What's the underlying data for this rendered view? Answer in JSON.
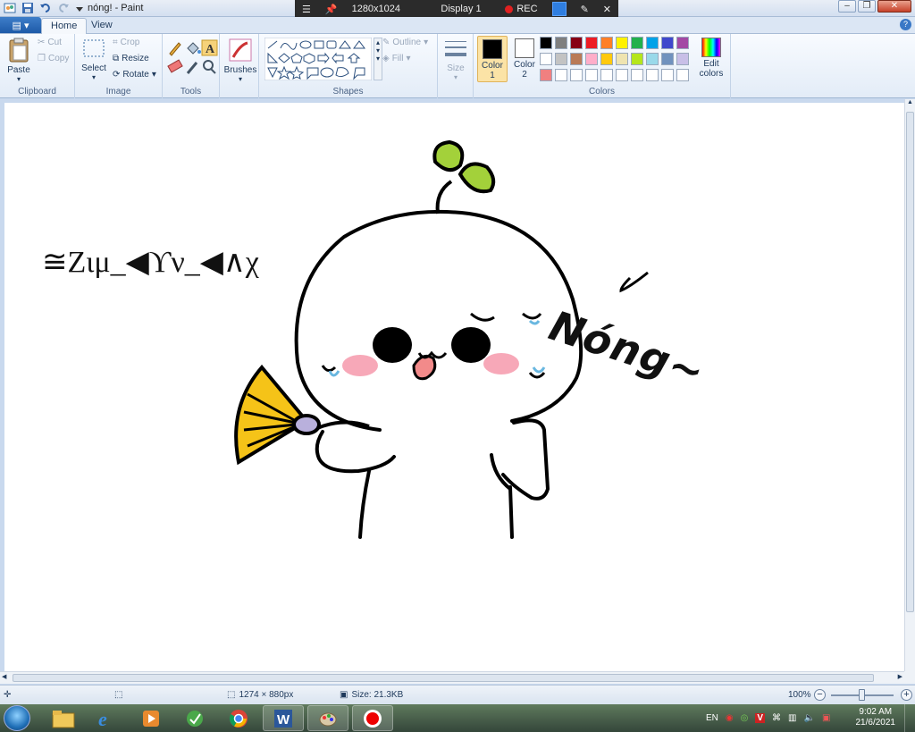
{
  "window": {
    "title": "nóng! - Paint"
  },
  "recorder": {
    "resolution": "1280x1024",
    "display": "Display 1",
    "rec_label": "REC"
  },
  "tabs": [
    {
      "label": "Home"
    },
    {
      "label": "View"
    }
  ],
  "clipboard": {
    "paste": "Paste",
    "cut": "Cut",
    "copy": "Copy",
    "group": "Clipboard"
  },
  "image": {
    "select": "Select",
    "crop": "Crop",
    "resize": "Resize",
    "rotate": "Rotate",
    "group": "Image"
  },
  "tools": {
    "group": "Tools",
    "brushes": "Brushes"
  },
  "shapes": {
    "outline": "Outline",
    "fill": "Fill",
    "group": "Shapes",
    "size": "Size"
  },
  "colors": {
    "color1": "Color",
    "color1_num": "1",
    "color2": "Color",
    "color2_num": "2",
    "edit": "Edit",
    "edit2": "colors",
    "group": "Colors",
    "palette_row1": [
      "#000000",
      "#7f7f7f",
      "#880015",
      "#ed1c24",
      "#ff7f27",
      "#fff200",
      "#22b14c",
      "#00a2e8",
      "#3f48cc",
      "#a349a4"
    ],
    "palette_row2": [
      "#ffffff",
      "#c3c3c3",
      "#b97a57",
      "#ffaec9",
      "#ffc90e",
      "#efe4b0",
      "#b5e61d",
      "#99d9ea",
      "#7092be",
      "#c8bfe7"
    ],
    "palette_row3": [
      "#f08080",
      "#ffffff",
      "#ffffff",
      "#ffffff",
      "#ffffff",
      "#ffffff",
      "#ffffff",
      "#ffffff",
      "#ffffff",
      "#ffffff"
    ]
  },
  "canvas": {
    "garbled_text": "≅Ζιμ_◀ϒν_◀∧χ",
    "handwritten": "Nóng~"
  },
  "status": {
    "dimensions": "1274 × 880px",
    "size": "Size: 21.3KB",
    "zoom": "100%"
  },
  "tray": {
    "lang": "EN",
    "time": "9:02 AM",
    "date": "21/6/2021"
  }
}
